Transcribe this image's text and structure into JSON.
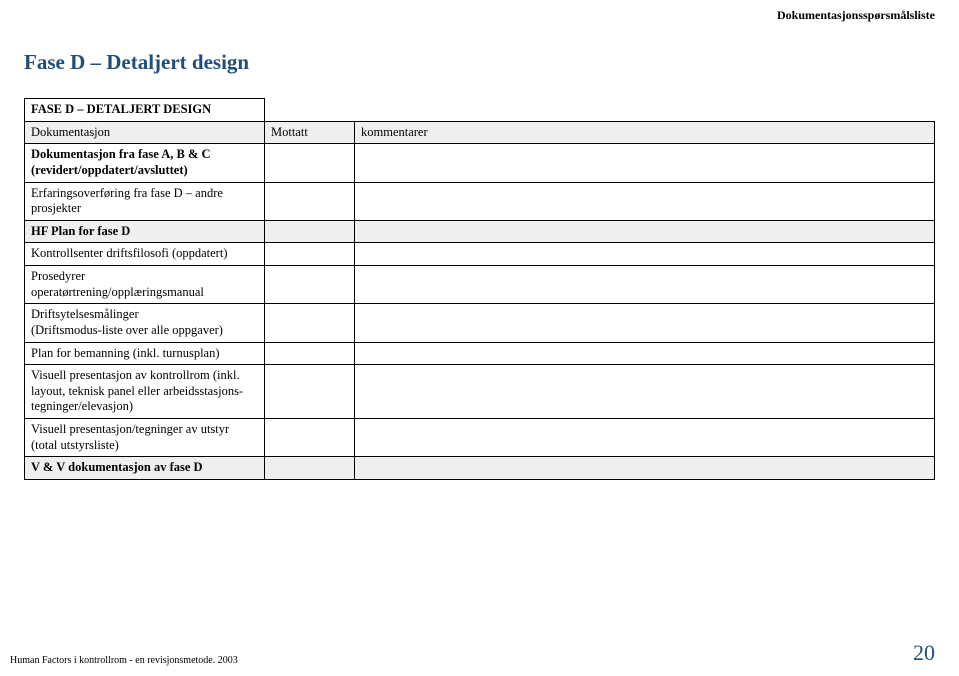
{
  "header_right": "Dokumentasjonsspørsmålsliste",
  "title": "Fase D – Detaljert design",
  "table": {
    "title_row": "FASE D – DETALJERT DESIGN",
    "columns": [
      "Dokumentasjon",
      "Mottatt",
      "kommentarer"
    ],
    "rows": [
      {
        "text": "Dokumentasjon fra fase A, B & C (revidert/oppdatert/avsluttet)",
        "bold": true
      },
      {
        "text": "Erfaringsoverføring fra fase D – andre prosjekter"
      },
      {
        "text": "HF Plan for fase D",
        "shaded": true,
        "bold": true
      },
      {
        "text": "Kontrollsenter driftsfilosofi (oppdatert)"
      },
      {
        "text": "Prosedyrer operatørtrening/opplæringsmanual"
      },
      {
        "text": "Driftsytelsesmålinger\n(Driftsmodus-liste over alle oppgaver)"
      },
      {
        "text": "Plan for bemanning (inkl. turnusplan)"
      },
      {
        "text": "Visuell presentasjon av kontrollrom (inkl. layout, teknisk panel eller arbeidsstasjons-tegninger/elevasjon)"
      },
      {
        "text": "Visuell presentasjon/tegninger av utstyr (total utstyrsliste)"
      },
      {
        "text": "V & V dokumentasjon av fase D",
        "shaded": true,
        "bold": true
      }
    ]
  },
  "footer_left": "Human Factors i kontrollrom - en revisjonsmetode. 2003",
  "footer_right": "20"
}
